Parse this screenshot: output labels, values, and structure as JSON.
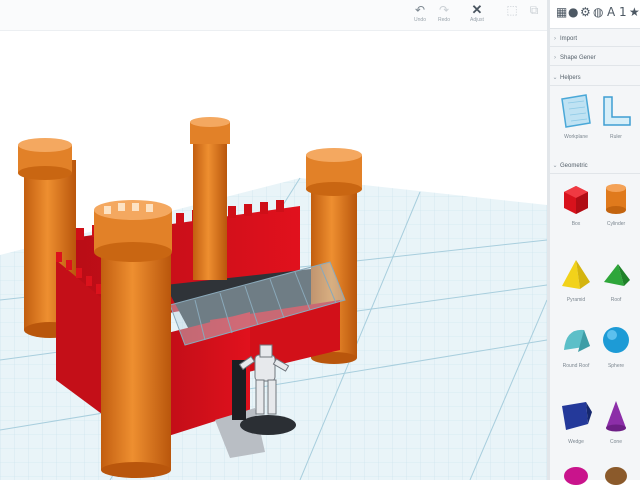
{
  "toolbar": {
    "undo": {
      "icon": "undo-icon",
      "label": "Undo"
    },
    "redo": {
      "icon": "redo-icon",
      "label": "Redo"
    },
    "adjust": {
      "icon": "adjust-icon",
      "label": "Adjust"
    },
    "group": {
      "icon": "group-icon"
    },
    "ungroup": {
      "icon": "ungroup-icon"
    }
  },
  "panel": {
    "icons": [
      "grid-icon",
      "sphere-icon",
      "gear-icon",
      "globe-icon",
      "A",
      "1",
      "star-icon"
    ],
    "sections": {
      "import": "Import",
      "shape_gen": "Shape Gener",
      "helpers": "Helpers",
      "geometric": "Geometric"
    },
    "helpers": [
      {
        "name": "Workplane",
        "icon": "workplane-icon"
      },
      {
        "name": "Ruler",
        "icon": "ruler-icon"
      }
    ],
    "shapes": [
      {
        "name": "Box",
        "color": "#d8121c"
      },
      {
        "name": "Cylinder",
        "color": "#e07a1c"
      },
      {
        "name": "Pyramid",
        "color": "#f2d21a"
      },
      {
        "name": "Roof",
        "color": "#2ea63a"
      },
      {
        "name": "Round Roof",
        "color": "#5cbfc8"
      },
      {
        "name": "Sphere",
        "color": "#1d9bd6"
      },
      {
        "name": "Wedge",
        "color": "#24399a"
      },
      {
        "name": "Cone",
        "color": "#8c2ea8"
      }
    ]
  }
}
